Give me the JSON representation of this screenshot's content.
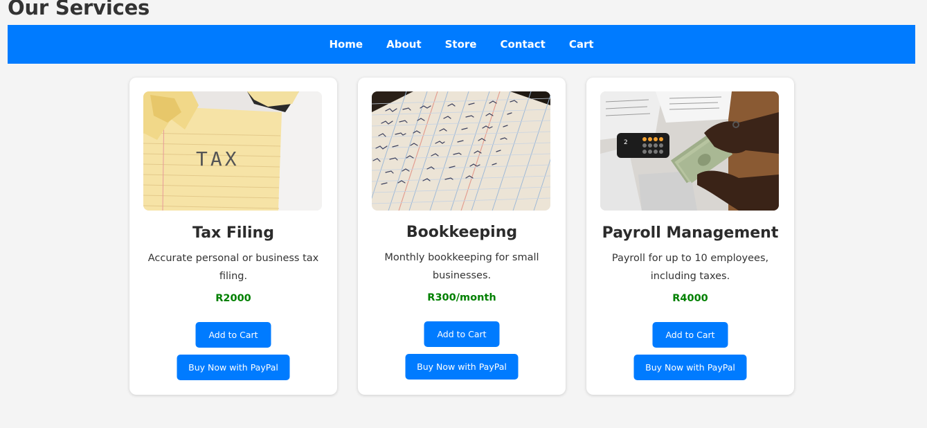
{
  "page": {
    "title": "Our Services"
  },
  "nav": {
    "items": [
      {
        "label": "Home"
      },
      {
        "label": "About"
      },
      {
        "label": "Store"
      },
      {
        "label": "Contact"
      },
      {
        "label": "Cart"
      }
    ]
  },
  "services": [
    {
      "title": "Tax Filing",
      "description": "Accurate personal or business tax filing.",
      "price": "R2000",
      "add_to_cart_label": "Add to Cart",
      "paypal_label": "Buy Now with PayPal",
      "image_text": "TAX"
    },
    {
      "title": "Bookkeeping",
      "description": "Monthly bookkeeping for small businesses.",
      "price": "R300/month",
      "add_to_cart_label": "Add to Cart",
      "paypal_label": "Buy Now with PayPal"
    },
    {
      "title": "Payroll Management",
      "description": "Payroll for up to 10 employees, including taxes.",
      "price": "R4000",
      "add_to_cart_label": "Add to Cart",
      "paypal_label": "Buy Now with PayPal",
      "image_text": "2"
    }
  ],
  "colors": {
    "primary": "#007bff",
    "price": "#008000",
    "background": "#f4f4f4",
    "card": "#ffffff"
  }
}
